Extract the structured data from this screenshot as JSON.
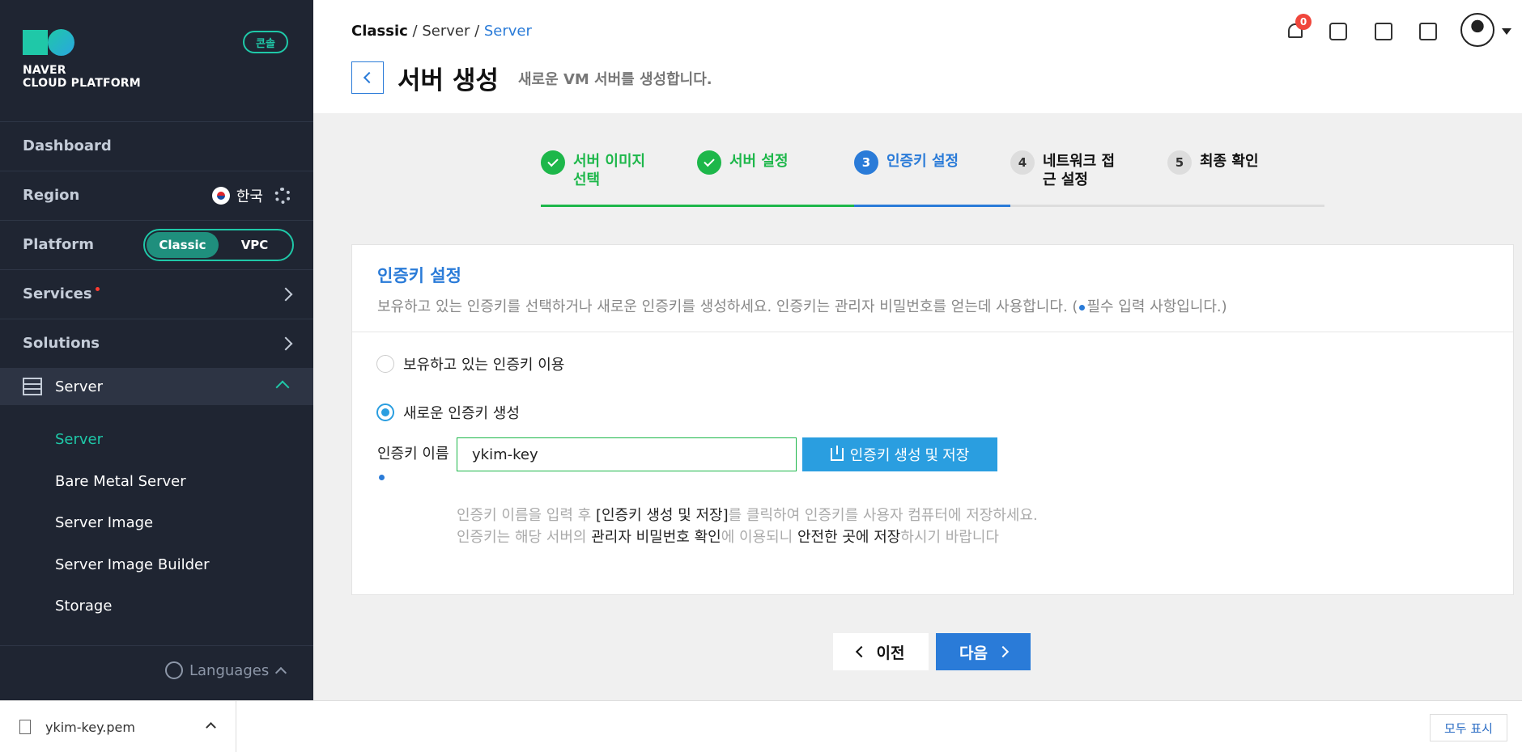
{
  "brand": {
    "line1": "NAVER",
    "line2": "CLOUD PLATFORM",
    "console_label": "콘솔"
  },
  "sidebar": {
    "dashboard": "Dashboard",
    "region_label": "Region",
    "region_value": "한국",
    "platform_label": "Platform",
    "platform_options": [
      "Classic",
      "VPC"
    ],
    "platform_selected": "Classic",
    "services": "Services",
    "solutions": "Solutions",
    "server_group": "Server",
    "sub_items": [
      "Server",
      "Bare Metal Server",
      "Server Image",
      "Server Image Builder",
      "Storage"
    ],
    "active_sub": "Server",
    "languages": "Languages"
  },
  "header": {
    "breadcrumb": [
      "Classic",
      "Server",
      "Server"
    ],
    "title": "서버 생성",
    "subtitle": "새로운 VM 서버를 생성합니다.",
    "notification_count": "0"
  },
  "steps": [
    {
      "num": "1",
      "label": "서버 이미지 선택",
      "state": "done"
    },
    {
      "num": "2",
      "label": "서버 설정",
      "state": "done"
    },
    {
      "num": "3",
      "label": "인증키 설정",
      "state": "current"
    },
    {
      "num": "4",
      "label": "네트워크 접근 설정",
      "state": "todo"
    },
    {
      "num": "5",
      "label": "최종 확인",
      "state": "todo"
    }
  ],
  "panel": {
    "title": "인증키 설정",
    "desc_prefix": "보유하고 있는 인증키를 선택하거나 새로운 인증키를 생성하세요. 인증키는 관리자 비밀번호를 얻는데 사용합니다. (",
    "desc_suffix": "필수 입력 사항입니다.)",
    "option_existing": "보유하고 있는 인증키 이용",
    "option_new": "새로운 인증키 생성",
    "selected_option": "new",
    "key_name_label": "인증키 이름",
    "key_name_value": "ykim-key",
    "generate_button": "인증키 생성 및 저장",
    "note1_a": "인증키 이름을 입력 후 ",
    "note1_b": "[인증키 생성 및 저장]",
    "note1_c": "를 클릭하여 인증키를 사용자 컴퓨터에 저장하세요.",
    "note2_a": "인증키는 해당 서버의 ",
    "note2_b": "관리자 비밀번호 확인",
    "note2_c": "에 이용되니 ",
    "note2_d": "안전한 곳에 저장",
    "note2_e": "하시기 바랍니다"
  },
  "nav_buttons": {
    "prev": "이전",
    "next": "다음"
  },
  "download_bar": {
    "file_name": "ykim-key.pem",
    "show_all": "모두 표시"
  },
  "colors": {
    "accent_blue": "#2a7bd8",
    "success_green": "#1db74a",
    "brand_teal": "#1fc8a8",
    "sidebar_bg": "#1f2532"
  }
}
